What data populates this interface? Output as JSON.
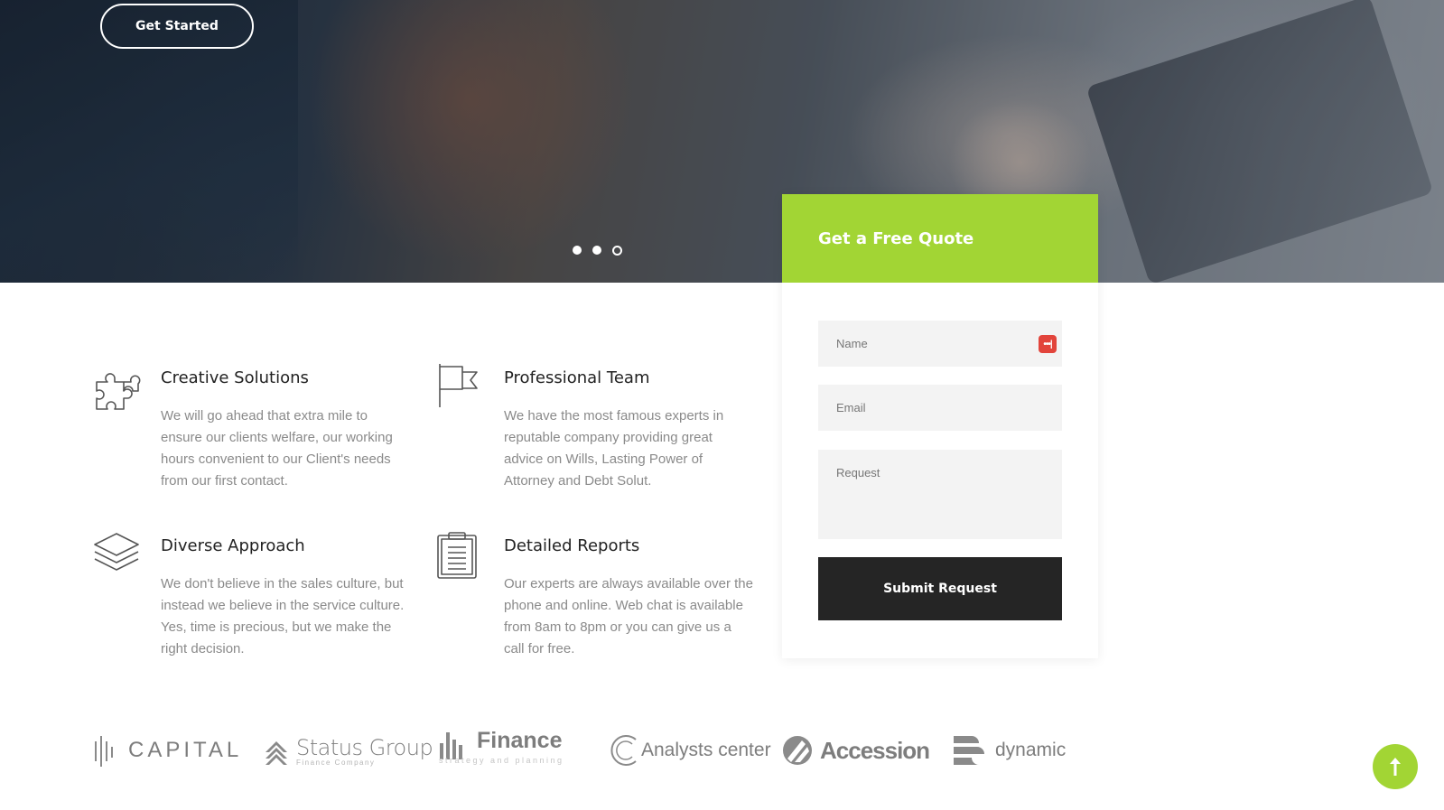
{
  "hero": {
    "cta_label": "Get Started",
    "slider": {
      "slide_count": 3,
      "active_index": 2
    }
  },
  "quote": {
    "title": "Get a Free Quote",
    "name_placeholder": "Name",
    "email_placeholder": "Email",
    "request_placeholder": "Request",
    "submit_label": "Submit Request",
    "accent_color": "#a2d534",
    "button_color": "#252525"
  },
  "features": [
    {
      "icon": "puzzle-icon",
      "title": "Creative Solutions",
      "text": "We will go ahead that extra mile to ensure our clients welfare, our working hours convenient to our Client's needs from our first contact."
    },
    {
      "icon": "flag-icon",
      "title": "Professional Team",
      "text": "We have the most famous experts in reputable company providing great advice on Wills, Lasting Power of Attorney and Debt Solut."
    },
    {
      "icon": "layers-icon",
      "title": "Diverse Approach",
      "text": "We don't believe in the sales culture, but instead we believe in the service culture. Yes, time is precious, but we make the right decision."
    },
    {
      "icon": "clipboard-icon",
      "title": "Detailed Reports",
      "text": "Our experts are always available over the phone and online. Web chat is available from 8am to 8pm or you can give us a call for free."
    }
  ],
  "logos": {
    "capital": "CAPITAL",
    "status_group": "Status Group",
    "status_group_sub": "Finance Company",
    "finance": "Finance",
    "finance_sub": "strategy and planning",
    "analysts": "Analysts center",
    "accession": "Accession",
    "dynamic": "dynamic"
  },
  "scroll_top": {
    "icon": "arrow-up-icon"
  }
}
